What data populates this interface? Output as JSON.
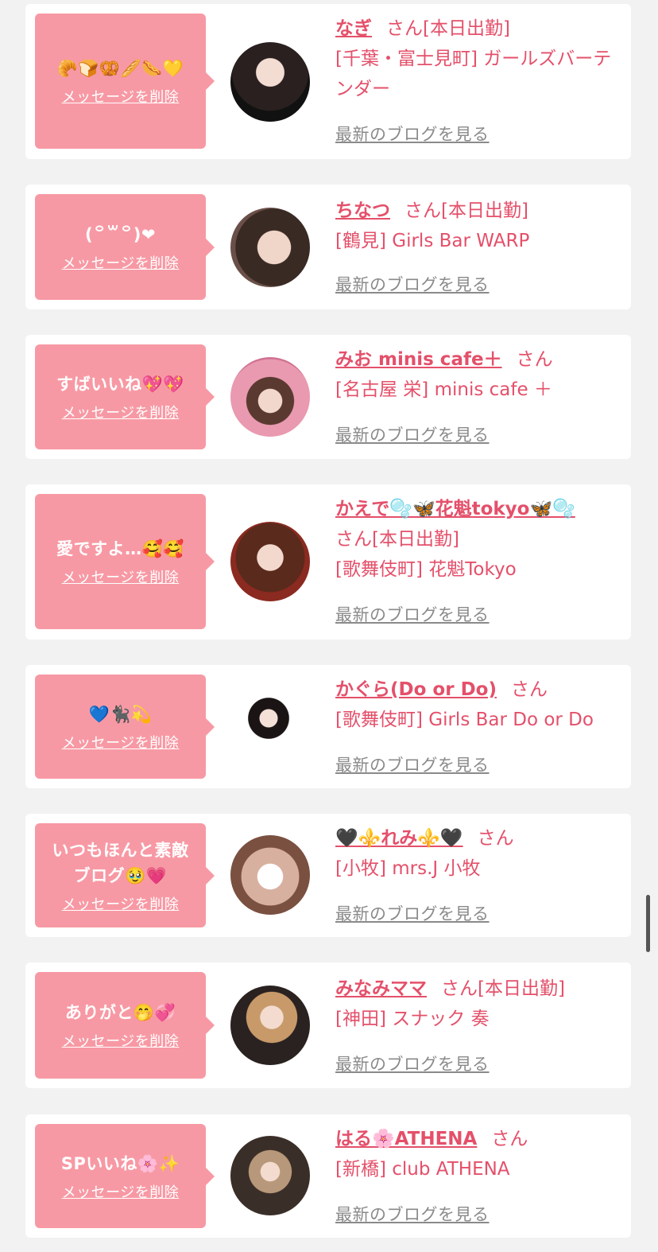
{
  "delete_label": "メッセージを削除",
  "blog_label": "最新のブログを見る",
  "san_label": "さん",
  "colors": {
    "accent": "#e4506a",
    "bubble": "#f799a4",
    "link_gray": "#8a8a8a"
  },
  "items": [
    {
      "message": "🥐🍞🥨🥖🌭💛",
      "name": "なぎ",
      "status": "[本日出勤]",
      "shop": "[千葉・富士見町] ガールズバーテンダー"
    },
    {
      "message": "(꒪꒳꒪)❤",
      "name": "ちなつ",
      "status": "[本日出勤]",
      "shop": "[鶴見] Girls Bar WARP"
    },
    {
      "message": "すばいいね💖💖",
      "name": "みお minis cafe＋",
      "status": "",
      "shop": "[名古屋 栄] minis cafe ＋"
    },
    {
      "message": "愛ですよ…🥰🥰",
      "name": "かえで🫧🦋花魁tokyo🦋🫧",
      "status": "[本日出勤]",
      "shop": "[歌舞伎町] 花魁Tokyo"
    },
    {
      "message": "💙🐈‍⬛💫",
      "name": "かぐら(Do or Do)",
      "status": "",
      "shop": "[歌舞伎町] Girls Bar Do or Do"
    },
    {
      "message": "いつもほんと素敵ブログ🥹💗",
      "name": "🖤⚜️れみ⚜️🖤",
      "status": "",
      "shop": "[小牧] mrs.J 小牧"
    },
    {
      "message": "ありがと🤭💞",
      "name": "みなみママ",
      "status": "[本日出勤]",
      "shop": "[神田] スナック 奏"
    },
    {
      "message": "SPいいね🌸✨",
      "name": "はる🌸ATHENA",
      "status": "",
      "shop": "[新橋] club ATHENA"
    }
  ]
}
